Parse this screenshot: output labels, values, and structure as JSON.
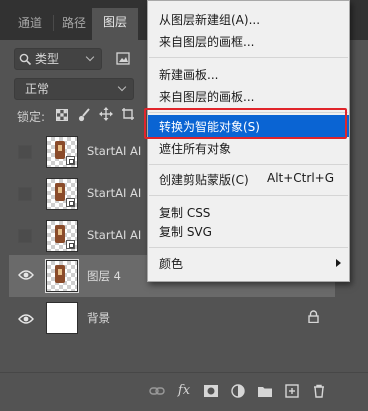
{
  "tabs": [
    {
      "label": "通道",
      "active": false
    },
    {
      "label": "路径",
      "active": false
    },
    {
      "label": "图层",
      "active": true
    }
  ],
  "filter": {
    "label": "类型"
  },
  "blend_mode": {
    "label": "正常"
  },
  "lock_label": "锁定:",
  "layers": [
    {
      "name": "StartAI AI",
      "visible": false,
      "selected": false
    },
    {
      "name": "StartAI AI",
      "visible": false,
      "selected": false
    },
    {
      "name": "StartAI AI",
      "visible": false,
      "selected": false
    },
    {
      "name": "图层 4",
      "visible": true,
      "selected": true
    },
    {
      "name": "背景",
      "visible": true,
      "selected": false,
      "locked": true
    }
  ],
  "context_menu": {
    "items": [
      {
        "label": "从图层新建组(A)..."
      },
      {
        "label": "来自图层的画框..."
      },
      {
        "label": "新建画板..."
      },
      {
        "label": "来自图层的画板..."
      },
      {
        "label": "转换为智能对象(S)",
        "highlighted": true
      },
      {
        "label": "遮住所有对象"
      },
      {
        "label": "创建剪贴蒙版(C)",
        "shortcut": "Alt+Ctrl+G"
      },
      {
        "label": "复制 CSS"
      },
      {
        "label": "复制 SVG"
      },
      {
        "label": "颜色",
        "submenu": true
      }
    ]
  },
  "bottom_icons": [
    "link-icon",
    "fx-icon",
    "mask-icon",
    "adjustment-icon",
    "folder-icon",
    "new-layer-icon",
    "trash-icon"
  ],
  "colors": {
    "highlight": "#0a64d3",
    "callout": "#e0242a",
    "panel": "#535353"
  }
}
